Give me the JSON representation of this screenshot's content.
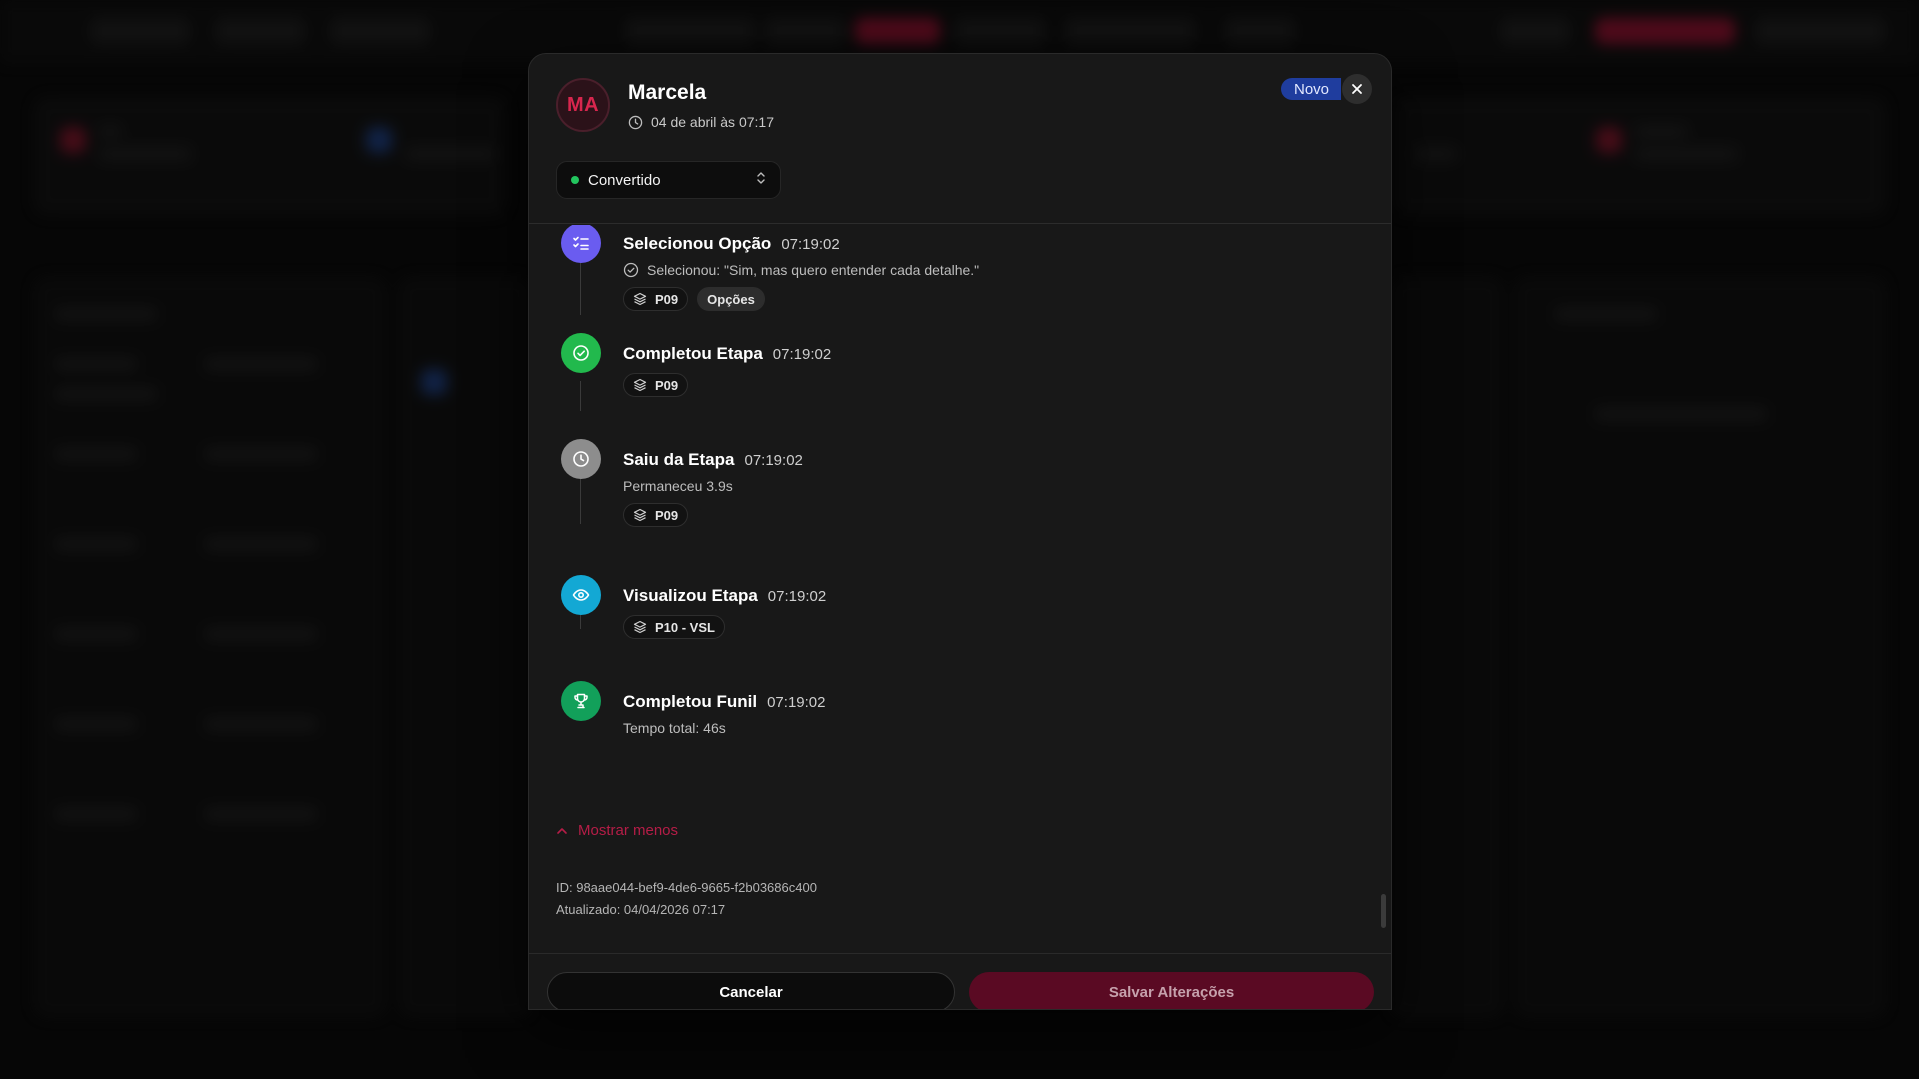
{
  "colors": {
    "accent": "#b51d47",
    "badge_blue": "#1f3d9e",
    "status_green": "#22c55e",
    "save_button": "#5a0a23"
  },
  "lead": {
    "initials": "MA",
    "name": "Marcela",
    "date": "04 de abril às 07:17",
    "badge": "Novo",
    "status": "Convertido"
  },
  "events": [
    {
      "title": "Selecionou Opção",
      "time": "07:19:02",
      "icon": "checklist-icon",
      "color": "#6a5cf0",
      "detail": "Selecionou: \"Sim, mas quero entender cada detalhe.\"",
      "tags": [
        "P09",
        "Opções"
      ]
    },
    {
      "title": "Completou Etapa",
      "time": "07:19:02",
      "icon": "check-circle-icon",
      "color": "#22b94d",
      "tags": [
        "P09"
      ]
    },
    {
      "title": "Saiu da Etapa",
      "time": "07:19:02",
      "icon": "clock-icon",
      "color": "#8d8d8d",
      "detail": "Permaneceu 3.9s",
      "tags": [
        "P09"
      ]
    },
    {
      "title": "Visualizou Etapa",
      "time": "07:19:02",
      "icon": "eye-icon",
      "color": "#13a8d4",
      "tags": [
        "P10 - VSL"
      ]
    },
    {
      "title": "Completou Funil",
      "time": "07:19:02",
      "icon": "trophy-icon",
      "color": "#12a05a",
      "detail": "Tempo total: 46s"
    }
  ],
  "show_less": "Mostrar menos",
  "meta": {
    "id": "ID: 98aae044-bef9-4de6-9665-f2b03686c400",
    "updated": "Atualizado: 04/04/2026 07:17"
  },
  "footer": {
    "cancel": "Cancelar",
    "save": "Salvar Alterações"
  }
}
